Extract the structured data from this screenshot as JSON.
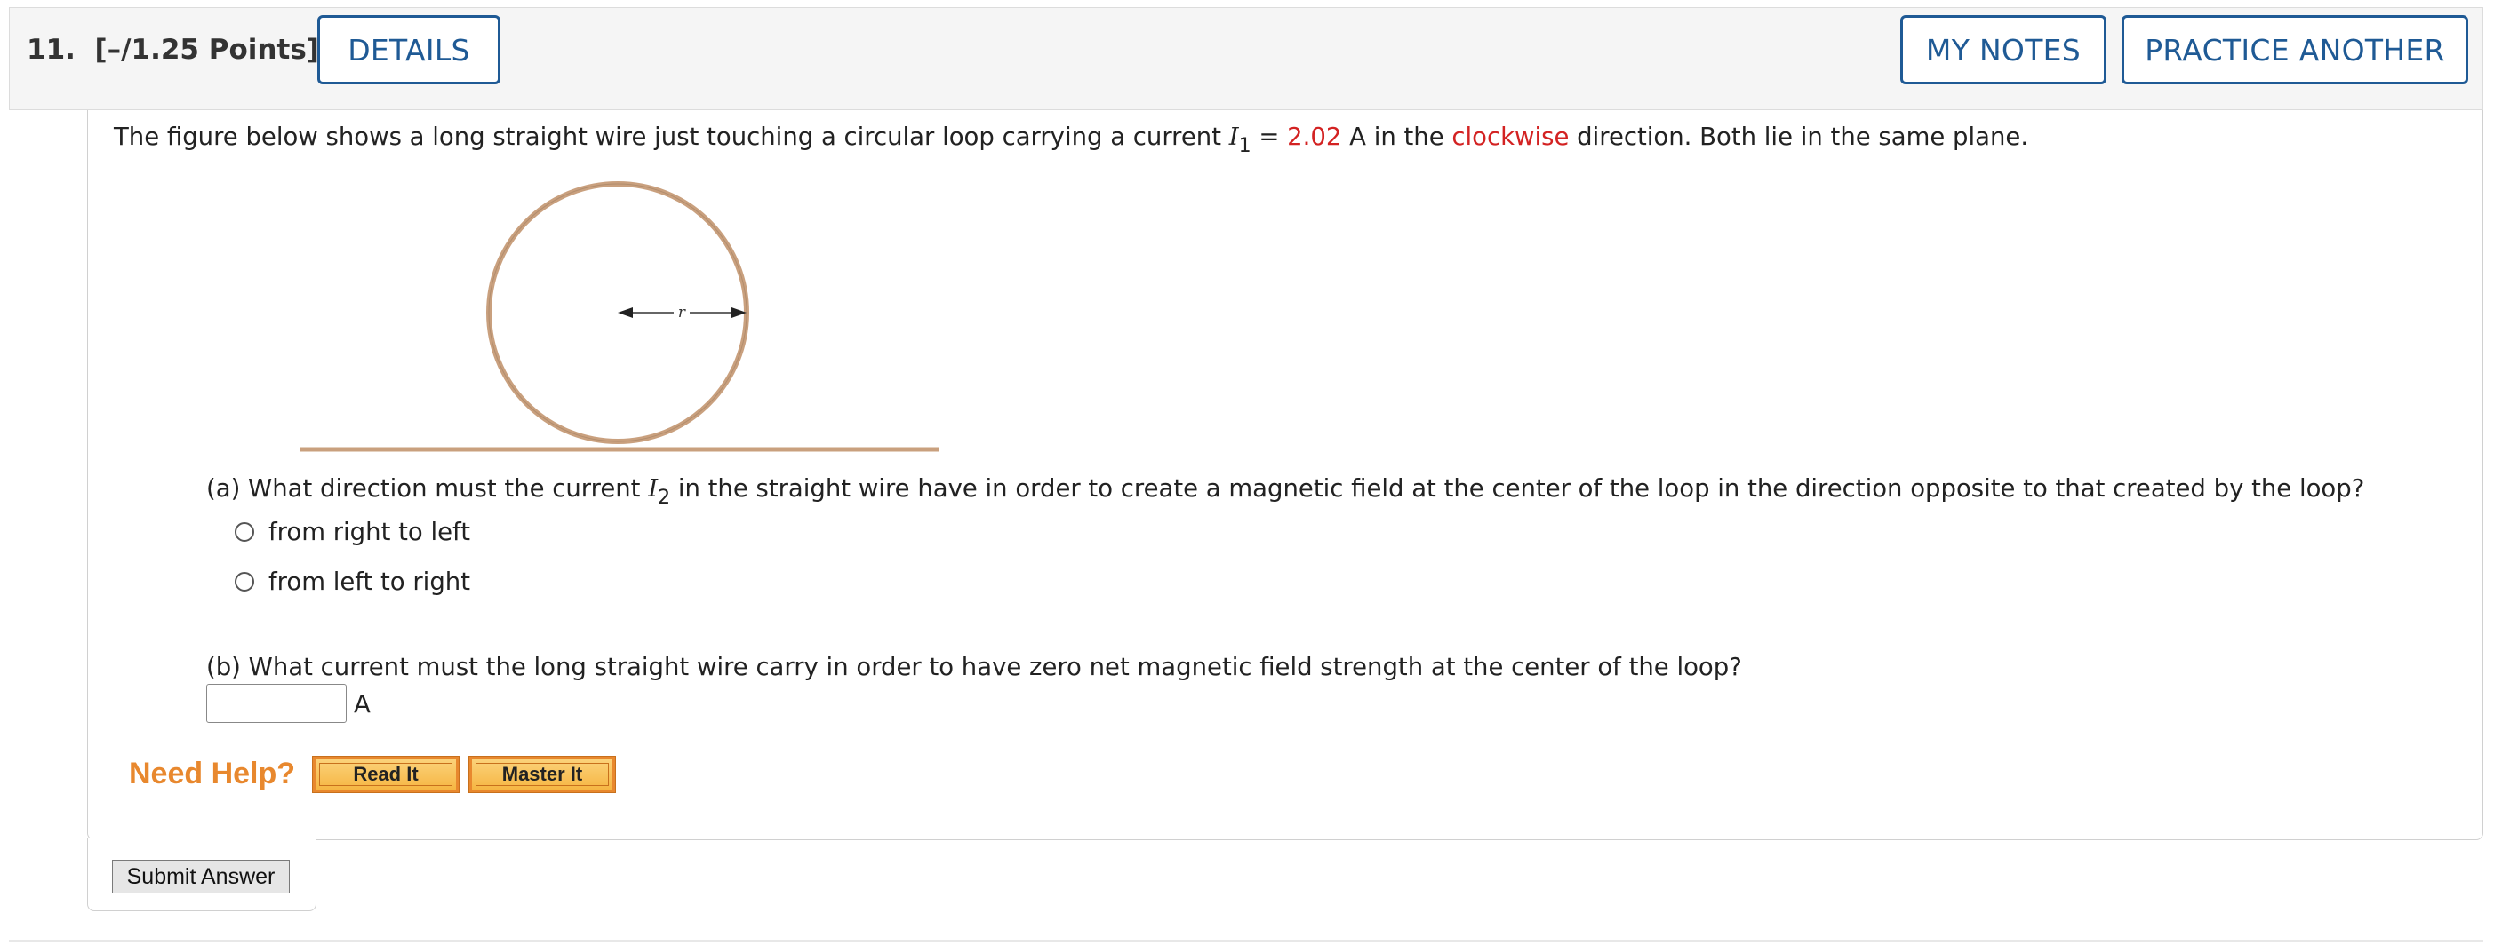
{
  "header": {
    "question_number": "11.",
    "points": "[–/1.25 Points]",
    "details_label": "DETAILS",
    "my_notes_label": "MY NOTES",
    "practice_another_label": "PRACTICE ANOTHER"
  },
  "intro": {
    "part1": "The figure below shows a long straight wire just touching a circular loop carrying a current ",
    "var": "I",
    "var_sub": "1",
    "equals": " = ",
    "value": "2.02",
    "part2": " A in the ",
    "direction": "clockwise",
    "part3": " direction. Both lie in the same plane."
  },
  "figure": {
    "radius_label": "r",
    "loop_color": "#c9a07e",
    "wire_color": "#c9a07e"
  },
  "part_a": {
    "prefix": "(a) What direction must the current ",
    "var": "I",
    "var_sub": "2",
    "suffix": " in the straight wire have in order to create a magnetic field at the center of the loop in the direction opposite to that created by the loop?",
    "options": [
      "from right to left",
      "from left to right"
    ]
  },
  "part_b": {
    "question": "(b) What current must the long straight wire carry in order to have zero net magnetic field strength at the center of the loop?",
    "input_value": "",
    "unit": "A"
  },
  "help": {
    "label": "Need Help?",
    "read_it": "Read It",
    "master_it": "Master It"
  },
  "submit_label": "Submit Answer",
  "colors": {
    "accent": "#1f5a95",
    "red_value": "#d32222",
    "need_help": "#e8882e",
    "help_button": "#f6b643"
  }
}
